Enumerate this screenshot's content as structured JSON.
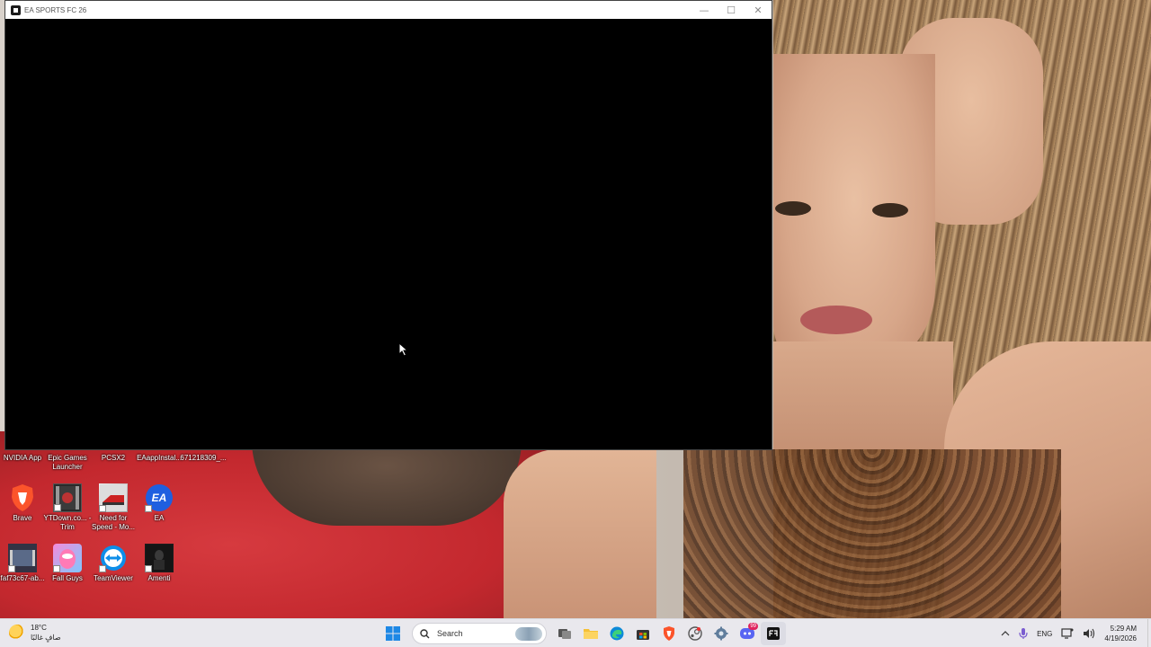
{
  "window": {
    "title": "EA SPORTS FC 26",
    "minimize_glyph": "—",
    "maximize_glyph": "☐",
    "close_glyph": "✕"
  },
  "desktop": {
    "row1": [
      {
        "label": "NVIDIA App",
        "icon": "nvidia-app-icon"
      },
      {
        "label": "Epic Games Launcher",
        "icon": "epic-games-icon"
      },
      {
        "label": "PCSX2",
        "icon": "pcsx2-icon"
      },
      {
        "label": "EAappInstal...",
        "icon": "ea-installer-icon"
      },
      {
        "label": "671218309_...",
        "icon": "file-icon"
      }
    ],
    "row2": [
      {
        "label": "Brave",
        "icon": "brave-icon"
      },
      {
        "label": "YTDown.co... - Trim",
        "icon": "video-file-icon"
      },
      {
        "label": "Need for Speed - Mo...",
        "icon": "need-for-speed-icon"
      },
      {
        "label": "EA",
        "icon": "ea-icon",
        "glyph": "EA"
      }
    ],
    "row3": [
      {
        "label": "faf73c67-ab...",
        "icon": "video-file-icon"
      },
      {
        "label": "Fall Guys",
        "icon": "fall-guys-icon"
      },
      {
        "label": "TeamViewer",
        "icon": "teamviewer-icon"
      },
      {
        "label": "Amenti",
        "icon": "amenti-icon"
      }
    ]
  },
  "taskbar": {
    "weather": {
      "temp": "18°C",
      "condition": "صافٍ غالبًا",
      "icon": "sun-icon"
    },
    "search_label": "Search",
    "apps": [
      "windows-start-icon",
      "task-view-icon",
      "file-explorer-icon",
      "edge-icon",
      "store-icon",
      "brave-icon",
      "steam-icon",
      "settings-icon",
      "discord-icon",
      "ea-fc-icon"
    ],
    "discord_badge": "99",
    "tray": {
      "chevron": "^",
      "language": "ENG",
      "time": "5:29 AM",
      "date": "4/19/2026"
    }
  },
  "colors": {
    "game_bg": "#000000",
    "titlebar_bg": "#ffffff",
    "taskbar_bg": "#eeeef4",
    "ea_blue": "#1f5fe0",
    "brave_orange": "#fb542b",
    "teamviewer_blue": "#0e8ee9"
  }
}
